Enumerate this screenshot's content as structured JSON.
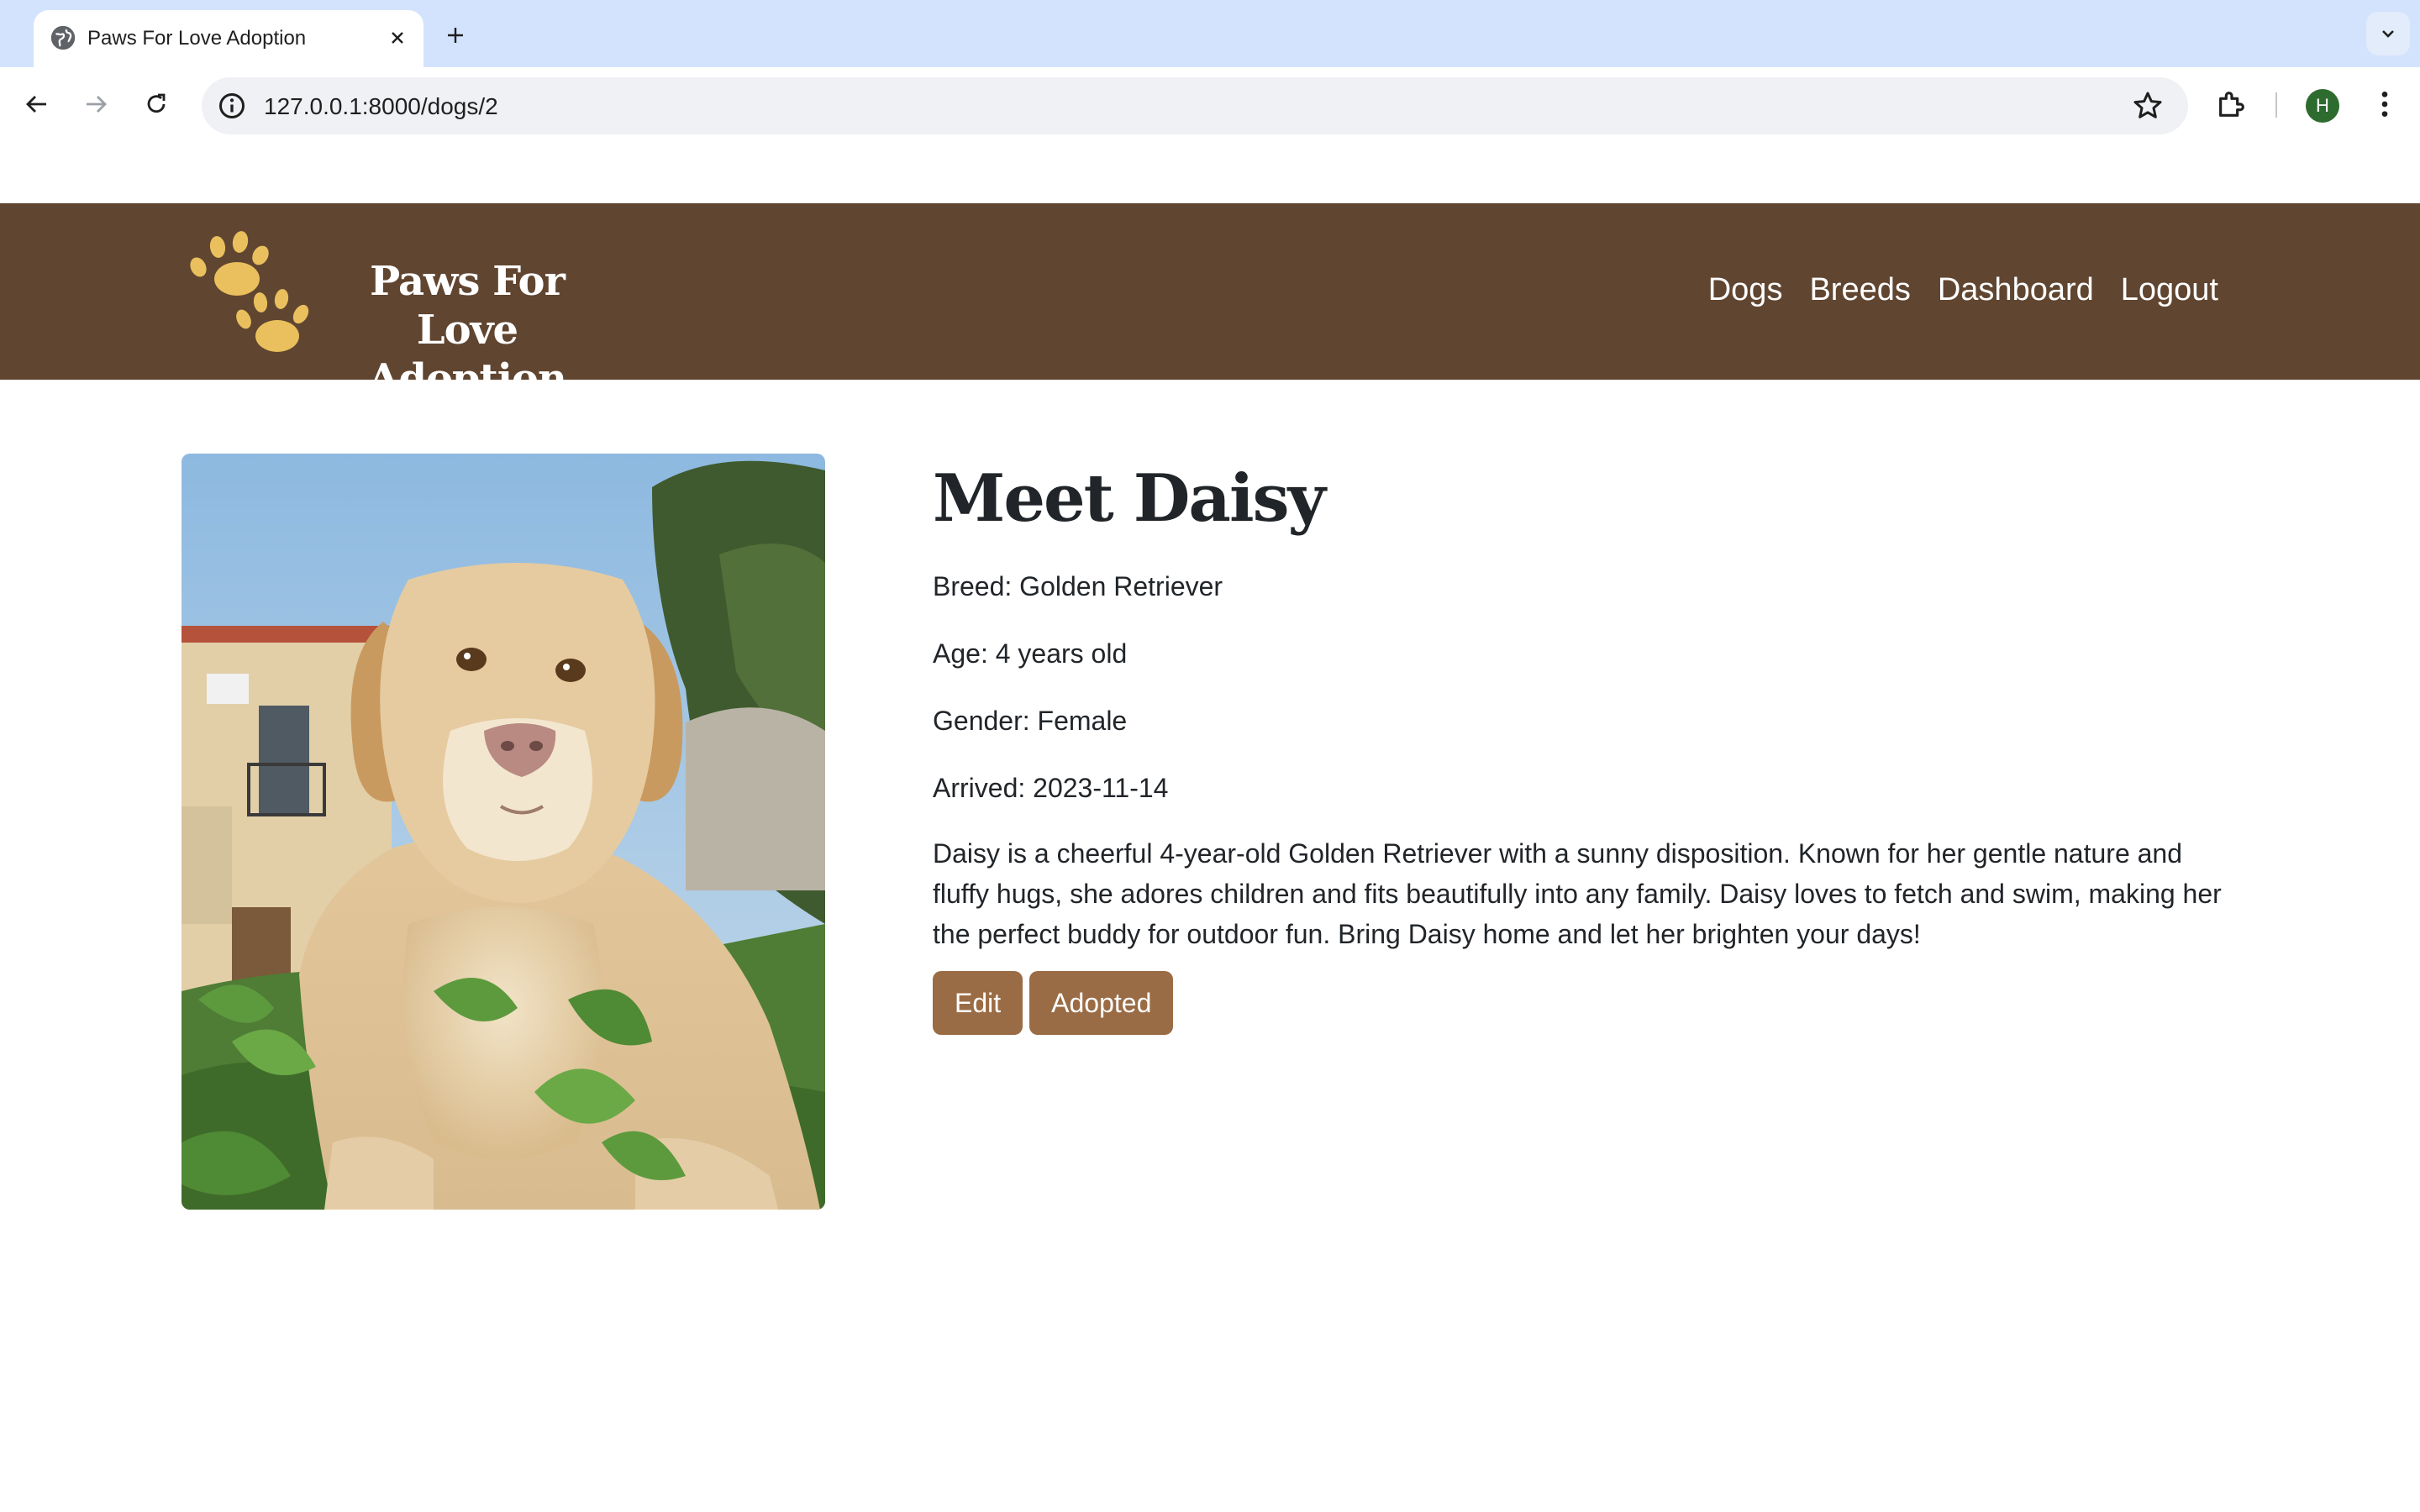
{
  "browser": {
    "tab_title": "Paws For Love Adoption",
    "url": "127.0.0.1:8000/dogs/2",
    "profile_initial": "H"
  },
  "site": {
    "brand_name": "Paws For Love Adoption",
    "nav": [
      "Dogs",
      "Breeds",
      "Dashboard",
      "Logout"
    ],
    "colors": {
      "header": "#604530",
      "paw": "#e9c05d",
      "button": "#9a6c45"
    }
  },
  "dog": {
    "heading": "Meet Daisy",
    "photo": "golden-retriever-lying-in-grass",
    "breed": "Breed: Golden Retriever",
    "age": "Age: 4 years old",
    "gender": "Gender: Female",
    "arrived": "Arrived: 2023-11-14",
    "description": "Daisy is a cheerful 4-year-old Golden Retriever with a sunny disposition. Known for her gentle nature and fluffy hugs, she adores children and fits beautifully into any family. Daisy loves to fetch and swim, making her the perfect buddy for outdoor fun. Bring Daisy home and let her brighten your days!",
    "buttons": {
      "edit": "Edit",
      "adopted": "Adopted"
    }
  }
}
